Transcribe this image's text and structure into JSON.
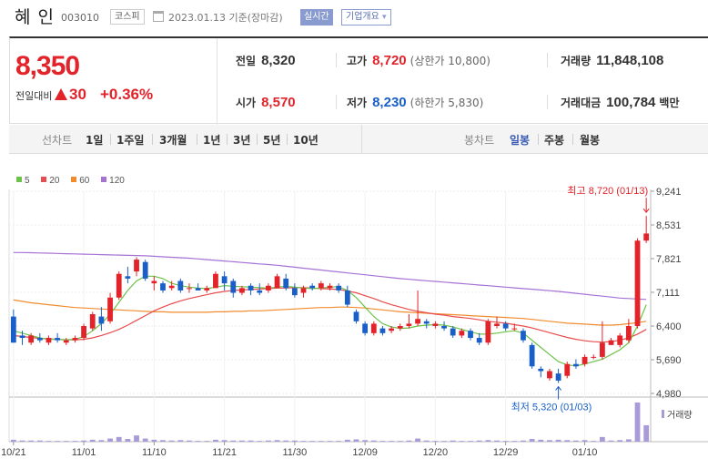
{
  "header": {
    "name": "혜 인",
    "code": "003010",
    "market": "코스피",
    "date": "2023.01.13  기준(장마감)",
    "realtime": "실시간",
    "overview": "기업개요",
    "overview_arrow": "▾"
  },
  "price": {
    "current": "8,350",
    "compare_label": "전일대비",
    "change": "30",
    "rate": "+0.36%",
    "prev_label": "전일",
    "prev": "8,320",
    "open_label": "시가",
    "open": "8,570",
    "high_label": "고가",
    "high": "8,720",
    "upper_label": "(상한가 10,800)",
    "low_label": "저가",
    "low": "8,230",
    "lower_label": "(하한가 5,830)",
    "volume_label": "거래량",
    "volume": "11,848,108",
    "amount_label": "거래대금",
    "amount": "100,784",
    "amount_unit": "백만"
  },
  "tabs": {
    "line_label": "선차트",
    "line_tabs": [
      "1일",
      "1주일",
      "3개월",
      "1년",
      "3년",
      "5년",
      "10년"
    ],
    "candle_label": "봉차트",
    "candle_tabs": [
      "일봉",
      "주봉",
      "월봉"
    ],
    "active_candle": "일봉"
  },
  "colors": {
    "up": "#e3232a",
    "down": "#1a5fc8",
    "ma5": "#6cc24a",
    "ma20": "#e84c4c",
    "ma60": "#f08c2e",
    "ma120": "#a672d6",
    "volume": "#a99bd8"
  },
  "chart_data": {
    "type": "candlestick",
    "legend": [
      {
        "name": "5",
        "color": "#6cc24a"
      },
      {
        "name": "20",
        "color": "#e84c4c"
      },
      {
        "name": "60",
        "color": "#f08c2e"
      },
      {
        "name": "120",
        "color": "#a672d6"
      }
    ],
    "y_ticks": [
      "9,241",
      "8,531",
      "7,821",
      "7,111",
      "6,400",
      "5,690",
      "4,980"
    ],
    "ylim": [
      4980,
      9241
    ],
    "x_ticks": [
      "10/21",
      "11/01",
      "11/10",
      "11/21",
      "11/30",
      "12/09",
      "12/20",
      "12/29",
      "01/10"
    ],
    "high_annotation": "최고 8,720 (01/13)",
    "low_annotation": "최저 5,320 (01/03)",
    "volume_label": "거래량",
    "candles": [
      [
        6600,
        6750,
        6050,
        6050
      ],
      [
        6200,
        6300,
        6000,
        6150
      ],
      [
        6050,
        6250,
        6000,
        6200
      ],
      [
        6150,
        6250,
        6050,
        6100
      ],
      [
        6050,
        6200,
        6000,
        6150
      ],
      [
        6150,
        6250,
        6050,
        6100
      ],
      [
        6050,
        6150,
        6000,
        6100
      ],
      [
        6100,
        6200,
        6050,
        6150
      ],
      [
        6150,
        6450,
        6100,
        6400
      ],
      [
        6350,
        6700,
        6300,
        6650
      ],
      [
        6600,
        6800,
        6300,
        6450
      ],
      [
        6500,
        7100,
        6450,
        7000
      ],
      [
        7000,
        7550,
        6950,
        7500
      ],
      [
        7450,
        7650,
        7300,
        7400
      ],
      [
        7550,
        7850,
        7450,
        7800
      ],
      [
        7750,
        7800,
        7350,
        7400
      ],
      [
        7300,
        7450,
        7150,
        7350
      ],
      [
        7300,
        7350,
        7100,
        7150
      ],
      [
        7200,
        7350,
        7150,
        7250
      ],
      [
        7350,
        7400,
        7100,
        7150
      ],
      [
        7200,
        7300,
        7100,
        7200
      ],
      [
        7200,
        7300,
        7150,
        7150
      ],
      [
        7150,
        7250,
        7100,
        7200
      ],
      [
        7200,
        7550,
        7200,
        7500
      ],
      [
        7450,
        7550,
        7150,
        7300
      ],
      [
        7350,
        7400,
        7000,
        7100
      ],
      [
        7100,
        7250,
        7050,
        7200
      ],
      [
        7250,
        7300,
        7050,
        7150
      ],
      [
        7150,
        7300,
        7050,
        7100
      ],
      [
        7150,
        7300,
        7100,
        7250
      ],
      [
        7200,
        7500,
        7200,
        7450
      ],
      [
        7400,
        7500,
        7150,
        7200
      ],
      [
        7200,
        7300,
        7000,
        7050
      ],
      [
        7100,
        7250,
        7000,
        7200
      ],
      [
        7250,
        7300,
        7150,
        7200
      ],
      [
        7200,
        7350,
        7150,
        7300
      ],
      [
        7200,
        7300,
        7150,
        7250
      ],
      [
        7250,
        7300,
        7100,
        7150
      ],
      [
        7150,
        7250,
        6800,
        6850
      ],
      [
        6700,
        6750,
        6450,
        6500
      ],
      [
        6450,
        6500,
        6200,
        6250
      ],
      [
        6250,
        6500,
        6200,
        6450
      ],
      [
        6350,
        6400,
        6200,
        6250
      ],
      [
        6300,
        6400,
        6250,
        6350
      ],
      [
        6350,
        6450,
        6300,
        6400
      ],
      [
        6400,
        6650,
        6350,
        6450
      ],
      [
        6450,
        7150,
        6400,
        6550
      ],
      [
        6500,
        6550,
        6350,
        6450
      ],
      [
        6400,
        6500,
        6350,
        6450
      ],
      [
        6400,
        6500,
        6300,
        6350
      ],
      [
        6350,
        6400,
        6150,
        6200
      ],
      [
        6200,
        6350,
        6150,
        6300
      ],
      [
        6300,
        6350,
        6100,
        6150
      ],
      [
        6150,
        6250,
        6000,
        6050
      ],
      [
        6050,
        6550,
        6000,
        6500
      ],
      [
        6400,
        6600,
        6350,
        6450
      ],
      [
        6450,
        6500,
        6300,
        6350
      ],
      [
        6350,
        6450,
        6300,
        6350
      ],
      [
        6300,
        6350,
        6050,
        6100
      ],
      [
        6000,
        6050,
        5500,
        5550
      ],
      [
        5500,
        5550,
        5320,
        5450
      ],
      [
        5300,
        5500,
        5250,
        5450
      ],
      [
        5400,
        5500,
        5200,
        5250
      ],
      [
        5350,
        5650,
        5300,
        5600
      ],
      [
        5600,
        5700,
        5500,
        5550
      ],
      [
        5600,
        5800,
        5550,
        5750
      ],
      [
        5750,
        5800,
        5700,
        5750
      ],
      [
        5750,
        6500,
        5700,
        6050
      ],
      [
        6000,
        6150,
        6000,
        6100
      ],
      [
        6000,
        6250,
        5950,
        6200
      ],
      [
        6100,
        6550,
        6050,
        6400
      ],
      [
        6400,
        8250,
        6350,
        8200
      ],
      [
        8200,
        8720,
        8150,
        8350
      ]
    ],
    "ma5": [
      6300,
      6250,
      6200,
      6150,
      6120,
      6120,
      6110,
      6120,
      6180,
      6300,
      6450,
      6650,
      6900,
      7150,
      7350,
      7450,
      7450,
      7400,
      7300,
      7250,
      7220,
      7200,
      7190,
      7220,
      7250,
      7240,
      7230,
      7220,
      7210,
      7200,
      7220,
      7240,
      7220,
      7200,
      7190,
      7200,
      7220,
      7230,
      7150,
      7000,
      6800,
      6600,
      6450,
      6380,
      6350,
      6360,
      6400,
      6420,
      6430,
      6420,
      6380,
      6330,
      6280,
      6230,
      6230,
      6250,
      6280,
      6300,
      6250,
      6100,
      5950,
      5800,
      5650,
      5580,
      5560,
      5600,
      5650,
      5700,
      5800,
      5900,
      6050,
      6400,
      6850
    ],
    "ma20": [
      6200,
      6180,
      6160,
      6140,
      6130,
      6120,
      6110,
      6110,
      6120,
      6150,
      6200,
      6260,
      6330,
      6420,
      6520,
      6620,
      6720,
      6800,
      6870,
      6930,
      6980,
      7020,
      7060,
      7100,
      7130,
      7150,
      7160,
      7170,
      7180,
      7190,
      7200,
      7200,
      7210,
      7210,
      7200,
      7190,
      7180,
      7170,
      7140,
      7100,
      7040,
      6980,
      6910,
      6850,
      6800,
      6750,
      6710,
      6680,
      6650,
      6630,
      6600,
      6580,
      6560,
      6530,
      6500,
      6480,
      6460,
      6430,
      6400,
      6360,
      6310,
      6260,
      6210,
      6160,
      6120,
      6090,
      6070,
      6060,
      6070,
      6100,
      6150,
      6230,
      6330
    ],
    "ma60": [
      6950,
      6920,
      6890,
      6870,
      6850,
      6830,
      6810,
      6790,
      6780,
      6770,
      6760,
      6750,
      6740,
      6730,
      6720,
      6710,
      6700,
      6700,
      6690,
      6690,
      6690,
      6690,
      6690,
      6700,
      6700,
      6710,
      6710,
      6720,
      6720,
      6730,
      6740,
      6750,
      6760,
      6770,
      6780,
      6790,
      6790,
      6800,
      6800,
      6790,
      6780,
      6760,
      6740,
      6720,
      6700,
      6690,
      6680,
      6670,
      6660,
      6650,
      6640,
      6630,
      6620,
      6610,
      6600,
      6590,
      6580,
      6570,
      6560,
      6540,
      6520,
      6500,
      6480,
      6460,
      6450,
      6440,
      6430,
      6420,
      6420,
      6430,
      6450,
      6470,
      6500
    ],
    "ma120": [
      7950,
      7950,
      7945,
      7940,
      7935,
      7930,
      7925,
      7920,
      7915,
      7910,
      7905,
      7900,
      7895,
      7890,
      7885,
      7880,
      7870,
      7860,
      7850,
      7840,
      7830,
      7815,
      7800,
      7785,
      7770,
      7755,
      7740,
      7725,
      7710,
      7695,
      7680,
      7660,
      7640,
      7620,
      7600,
      7580,
      7560,
      7540,
      7520,
      7500,
      7480,
      7460,
      7440,
      7420,
      7400,
      7385,
      7370,
      7355,
      7340,
      7325,
      7310,
      7295,
      7280,
      7265,
      7250,
      7235,
      7220,
      7205,
      7190,
      7175,
      7160,
      7145,
      7130,
      7110,
      7090,
      7070,
      7050,
      7030,
      7010,
      6990,
      6980,
      6970,
      6960
    ],
    "volumes": [
      0.05,
      0.03,
      0.03,
      0.03,
      0.02,
      0.02,
      0.02,
      0.02,
      0.03,
      0.05,
      0.04,
      0.08,
      0.12,
      0.07,
      0.16,
      0.08,
      0.05,
      0.04,
      0.03,
      0.04,
      0.03,
      0.02,
      0.02,
      0.05,
      0.04,
      0.03,
      0.03,
      0.03,
      0.02,
      0.03,
      0.04,
      0.03,
      0.03,
      0.02,
      0.02,
      0.02,
      0.02,
      0.02,
      0.05,
      0.06,
      0.04,
      0.03,
      0.02,
      0.02,
      0.02,
      0.03,
      0.08,
      0.03,
      0.02,
      0.02,
      0.03,
      0.02,
      0.02,
      0.03,
      0.04,
      0.03,
      0.02,
      0.02,
      0.03,
      0.07,
      0.05,
      0.04,
      0.05,
      0.04,
      0.03,
      0.04,
      0.02,
      0.12,
      0.03,
      0.04,
      0.06,
      1.0,
      0.42
    ]
  }
}
